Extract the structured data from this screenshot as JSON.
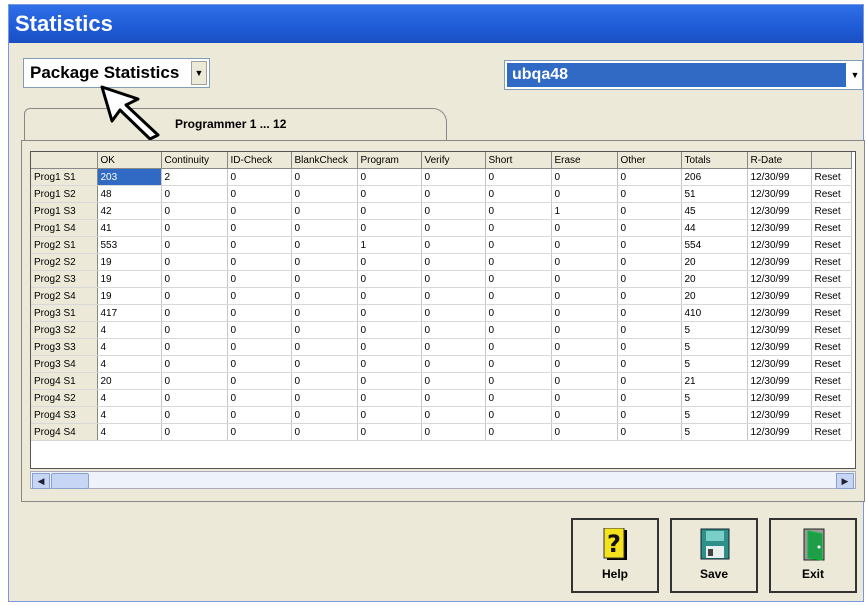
{
  "window": {
    "title": "Statistics"
  },
  "left_combo": {
    "value": "Package Statistics"
  },
  "right_combo": {
    "value": "ubqa48"
  },
  "tab": {
    "label": "Programmer 1 ... 12"
  },
  "grid": {
    "columns": [
      "",
      "OK",
      "Continuity",
      "ID-Check",
      "BlankCheck",
      "Program",
      "Verify",
      "Short",
      "Erase",
      "Other",
      "Totals",
      "R-Date",
      ""
    ],
    "rows": [
      [
        "Prog1 S1",
        "203",
        "2",
        "0",
        "0",
        "0",
        "0",
        "0",
        "0",
        "0",
        "206",
        "12/30/99",
        "Reset"
      ],
      [
        "Prog1 S2",
        "48",
        "0",
        "0",
        "0",
        "0",
        "0",
        "0",
        "0",
        "0",
        "51",
        "12/30/99",
        "Reset"
      ],
      [
        "Prog1 S3",
        "42",
        "0",
        "0",
        "0",
        "0",
        "0",
        "0",
        "1",
        "0",
        "45",
        "12/30/99",
        "Reset"
      ],
      [
        "Prog1 S4",
        "41",
        "0",
        "0",
        "0",
        "0",
        "0",
        "0",
        "0",
        "0",
        "44",
        "12/30/99",
        "Reset"
      ],
      [
        "Prog2 S1",
        "553",
        "0",
        "0",
        "0",
        "1",
        "0",
        "0",
        "0",
        "0",
        "554",
        "12/30/99",
        "Reset"
      ],
      [
        "Prog2 S2",
        "19",
        "0",
        "0",
        "0",
        "0",
        "0",
        "0",
        "0",
        "0",
        "20",
        "12/30/99",
        "Reset"
      ],
      [
        "Prog2 S3",
        "19",
        "0",
        "0",
        "0",
        "0",
        "0",
        "0",
        "0",
        "0",
        "20",
        "12/30/99",
        "Reset"
      ],
      [
        "Prog2 S4",
        "19",
        "0",
        "0",
        "0",
        "0",
        "0",
        "0",
        "0",
        "0",
        "20",
        "12/30/99",
        "Reset"
      ],
      [
        "Prog3 S1",
        "417",
        "0",
        "0",
        "0",
        "0",
        "0",
        "0",
        "0",
        "0",
        "410",
        "12/30/99",
        "Reset"
      ],
      [
        "Prog3 S2",
        "4",
        "0",
        "0",
        "0",
        "0",
        "0",
        "0",
        "0",
        "0",
        "5",
        "12/30/99",
        "Reset"
      ],
      [
        "Prog3 S3",
        "4",
        "0",
        "0",
        "0",
        "0",
        "0",
        "0",
        "0",
        "0",
        "5",
        "12/30/99",
        "Reset"
      ],
      [
        "Prog3 S4",
        "4",
        "0",
        "0",
        "0",
        "0",
        "0",
        "0",
        "0",
        "0",
        "5",
        "12/30/99",
        "Reset"
      ],
      [
        "Prog4 S1",
        "20",
        "0",
        "0",
        "0",
        "0",
        "0",
        "0",
        "0",
        "0",
        "21",
        "12/30/99",
        "Reset"
      ],
      [
        "Prog4 S2",
        "4",
        "0",
        "0",
        "0",
        "0",
        "0",
        "0",
        "0",
        "0",
        "5",
        "12/30/99",
        "Reset"
      ],
      [
        "Prog4 S3",
        "4",
        "0",
        "0",
        "0",
        "0",
        "0",
        "0",
        "0",
        "0",
        "5",
        "12/30/99",
        "Reset"
      ],
      [
        "Prog4 S4",
        "4",
        "0",
        "0",
        "0",
        "0",
        "0",
        "0",
        "0",
        "0",
        "5",
        "12/30/99",
        "Reset"
      ]
    ]
  },
  "buttons": {
    "help": {
      "label": "Help",
      "icon": "question-mark-icon"
    },
    "save": {
      "label": "Save",
      "icon": "floppy-disk-icon"
    },
    "exit": {
      "label": "Exit",
      "icon": "exit-door-icon"
    }
  },
  "colors": {
    "titlebar": "#1f5bd6",
    "selection": "#316ac5",
    "face": "#ece9d8"
  }
}
